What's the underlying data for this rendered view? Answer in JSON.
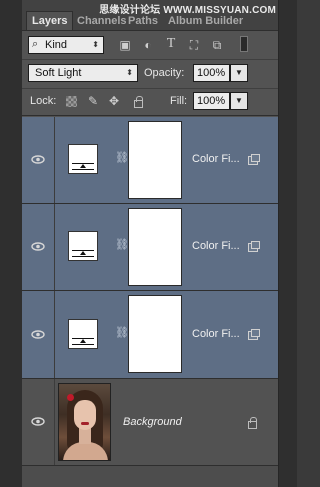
{
  "tabs": [
    {
      "label": "Layers"
    },
    {
      "label": "Channels"
    },
    {
      "label": "Paths"
    },
    {
      "label": "Album Builder"
    }
  ],
  "watermark": "思缘设计论坛 WWW.MISSYUAN.COM",
  "filter": {
    "kind_label": "Kind"
  },
  "blend": {
    "mode": "Soft Light",
    "opacity_label": "Opacity:",
    "opacity_value": "100%"
  },
  "lockrow": {
    "lock_label": "Lock:",
    "fill_label": "Fill:",
    "fill_value": "100%"
  },
  "layers": [
    {
      "name": "Color Fi...",
      "selected": true,
      "type": "adjustment"
    },
    {
      "name": "Color Fi...",
      "selected": true,
      "type": "adjustment"
    },
    {
      "name": "Color Fi...",
      "selected": true,
      "type": "adjustment"
    },
    {
      "name": "Background",
      "selected": false,
      "type": "image",
      "locked": true
    }
  ],
  "colors": {
    "panel": "#535353",
    "selected_row": "#5e6e85",
    "field": "#ececec"
  },
  "icons": [
    "search-icon",
    "pixel-filter-icon",
    "adjustment-filter-icon",
    "type-filter-icon",
    "shape-filter-icon",
    "smart-object-filter-icon",
    "filter-toggle-icon",
    "lock-transparent-icon",
    "lock-paint-icon",
    "lock-move-icon",
    "lock-all-icon",
    "visibility-eye-icon",
    "link-chain-icon",
    "layer-style-icon",
    "lock-icon"
  ]
}
